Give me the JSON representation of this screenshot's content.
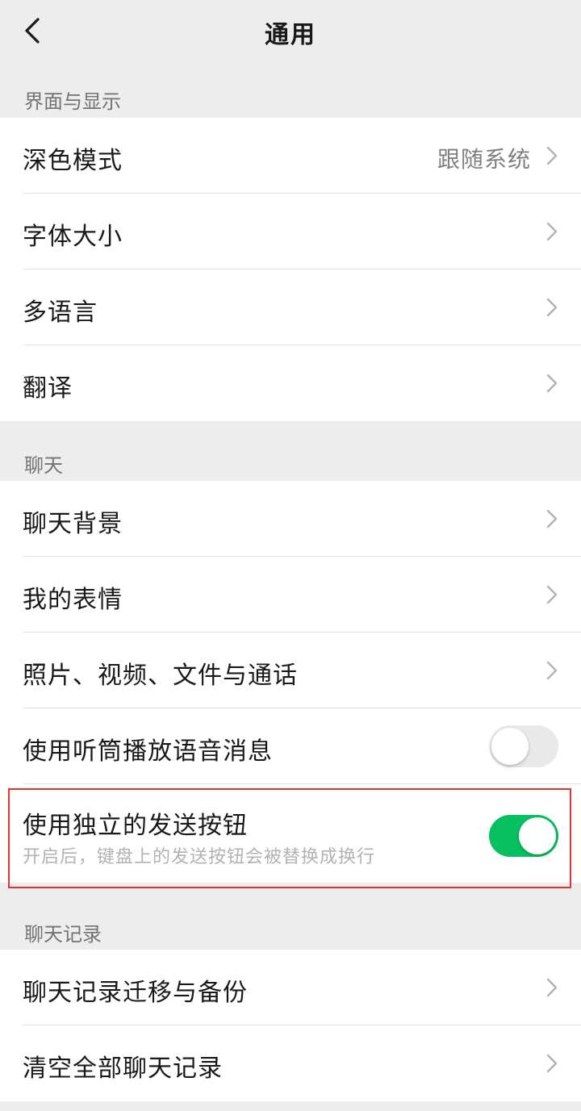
{
  "header": {
    "title": "通用"
  },
  "sections": [
    {
      "title": "界面与显示",
      "items": [
        {
          "label": "深色模式",
          "value": "跟随系统"
        },
        {
          "label": "字体大小"
        },
        {
          "label": "多语言"
        },
        {
          "label": "翻译"
        }
      ]
    },
    {
      "title": "聊天",
      "items": [
        {
          "label": "聊天背景"
        },
        {
          "label": "我的表情"
        },
        {
          "label": "照片、视频、文件与通话"
        },
        {
          "label": "使用听筒播放语音消息",
          "toggle": false
        },
        {
          "label": "使用独立的发送按钮",
          "sublabel": "开启后，键盘上的发送按钮会被替换成换行",
          "toggle": true
        }
      ]
    },
    {
      "title": "聊天记录",
      "items": [
        {
          "label": "聊天记录迁移与备份"
        },
        {
          "label": "清空全部聊天记录"
        }
      ]
    }
  ],
  "colors": {
    "accent": "#07c160",
    "highlight_border": "#e3342f",
    "background": "#ededed"
  },
  "icons": {
    "back": "chevron-left-icon",
    "chevron": "chevron-right-icon"
  }
}
